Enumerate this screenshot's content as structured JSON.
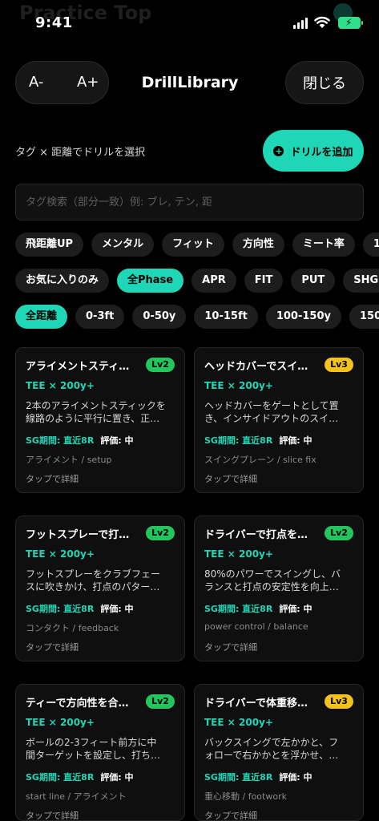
{
  "status_bar": {
    "time": "9:41",
    "behind_title": "Practice Top"
  },
  "header": {
    "font_decrease": "A-",
    "font_increase": "A+",
    "title": "DrillLibrary",
    "close": "閉じる"
  },
  "toolbar": {
    "subtitle": "タグ × 距離でドリルを選択",
    "add_button": "ドリルを追加"
  },
  "search": {
    "placeholder": "タグ検索（部分一致）例: ブレ, テン, 距"
  },
  "tag_chips": [
    "飛距離UP",
    "メンタル",
    "フィット",
    "方向性",
    "ミート率",
    "1"
  ],
  "phase_chips": [
    "お気に入りのみ",
    "全Phase",
    "APR",
    "FIT",
    "PUT",
    "SHG"
  ],
  "distance_chips": [
    "全距離",
    "0-3ft",
    "0-50y",
    "10-15ft",
    "100-150y",
    "150-"
  ],
  "cards": [
    {
      "title": "アライメントスティ…",
      "level": "Lv2",
      "level_color": "#22c55e",
      "tee": "TEE × 200y+",
      "desc_line1": "2本のアライメントスティックを",
      "desc_line2": "線路のように平行に置き、正…",
      "sg_period": "SG期間: 直近8R",
      "rating": "評価: 中",
      "tags": "アライメント / setup",
      "tap": "タップで詳細"
    },
    {
      "title": "ヘッドカバーでスイ…",
      "level": "Lv3",
      "level_color": "#f4c21c",
      "tee": "TEE × 200y+",
      "desc_line1": "ヘッドカバーをゲートとして置",
      "desc_line2": "き、インサイドアウトのスイ…",
      "sg_period": "SG期間: 直近8R",
      "rating": "評価: 中",
      "tags": "スイングプレーン / slice fix",
      "tap": "タップで詳細"
    },
    {
      "title": "フットスプレーで打…",
      "level": "Lv2",
      "level_color": "#22c55e",
      "tee": "TEE × 200y+",
      "desc_line1": "フットスプレーをクラブフェー",
      "desc_line2": "スに吹きかけ、打点のパター…",
      "sg_period": "SG期間: 直近8R",
      "rating": "評価: 中",
      "tags": "コンタクト / feedback",
      "tap": "タップで詳細"
    },
    {
      "title": "ドライバーで打点を…",
      "level": "Lv2",
      "level_color": "#22c55e",
      "tee": "TEE × 200y+",
      "desc_line1": "80%のパワーでスイングし、バ",
      "desc_line2": "ランスと打点の安定性を向上…",
      "sg_period": "SG期間: 直近8R",
      "rating": "評価: 中",
      "tags": "power control / balance",
      "tap": "タップで詳細"
    },
    {
      "title": "ティーで方向性を合…",
      "level": "Lv2",
      "level_color": "#22c55e",
      "tee": "TEE × 200y+",
      "desc_line1": "ボールの2-3フィート前方に中",
      "desc_line2": "間ターゲットを設定し、打ち…",
      "sg_period": "SG期間: 直近8R",
      "rating": "評価: 中",
      "tags": "start line / アライメント",
      "tap": "タップで詳細"
    },
    {
      "title": "ドライバーで体重移…",
      "level": "Lv3",
      "level_color": "#f4c21c",
      "tee": "TEE × 200y+",
      "desc_line1": "バックスイングで左かかと、フ",
      "desc_line2": "ォローで右かかとを浮かせ、…",
      "sg_period": "SG期間: 直近8R",
      "rating": "評価: 中",
      "tags": "重心移動 / footwork",
      "tap": "タップで詳細"
    }
  ]
}
